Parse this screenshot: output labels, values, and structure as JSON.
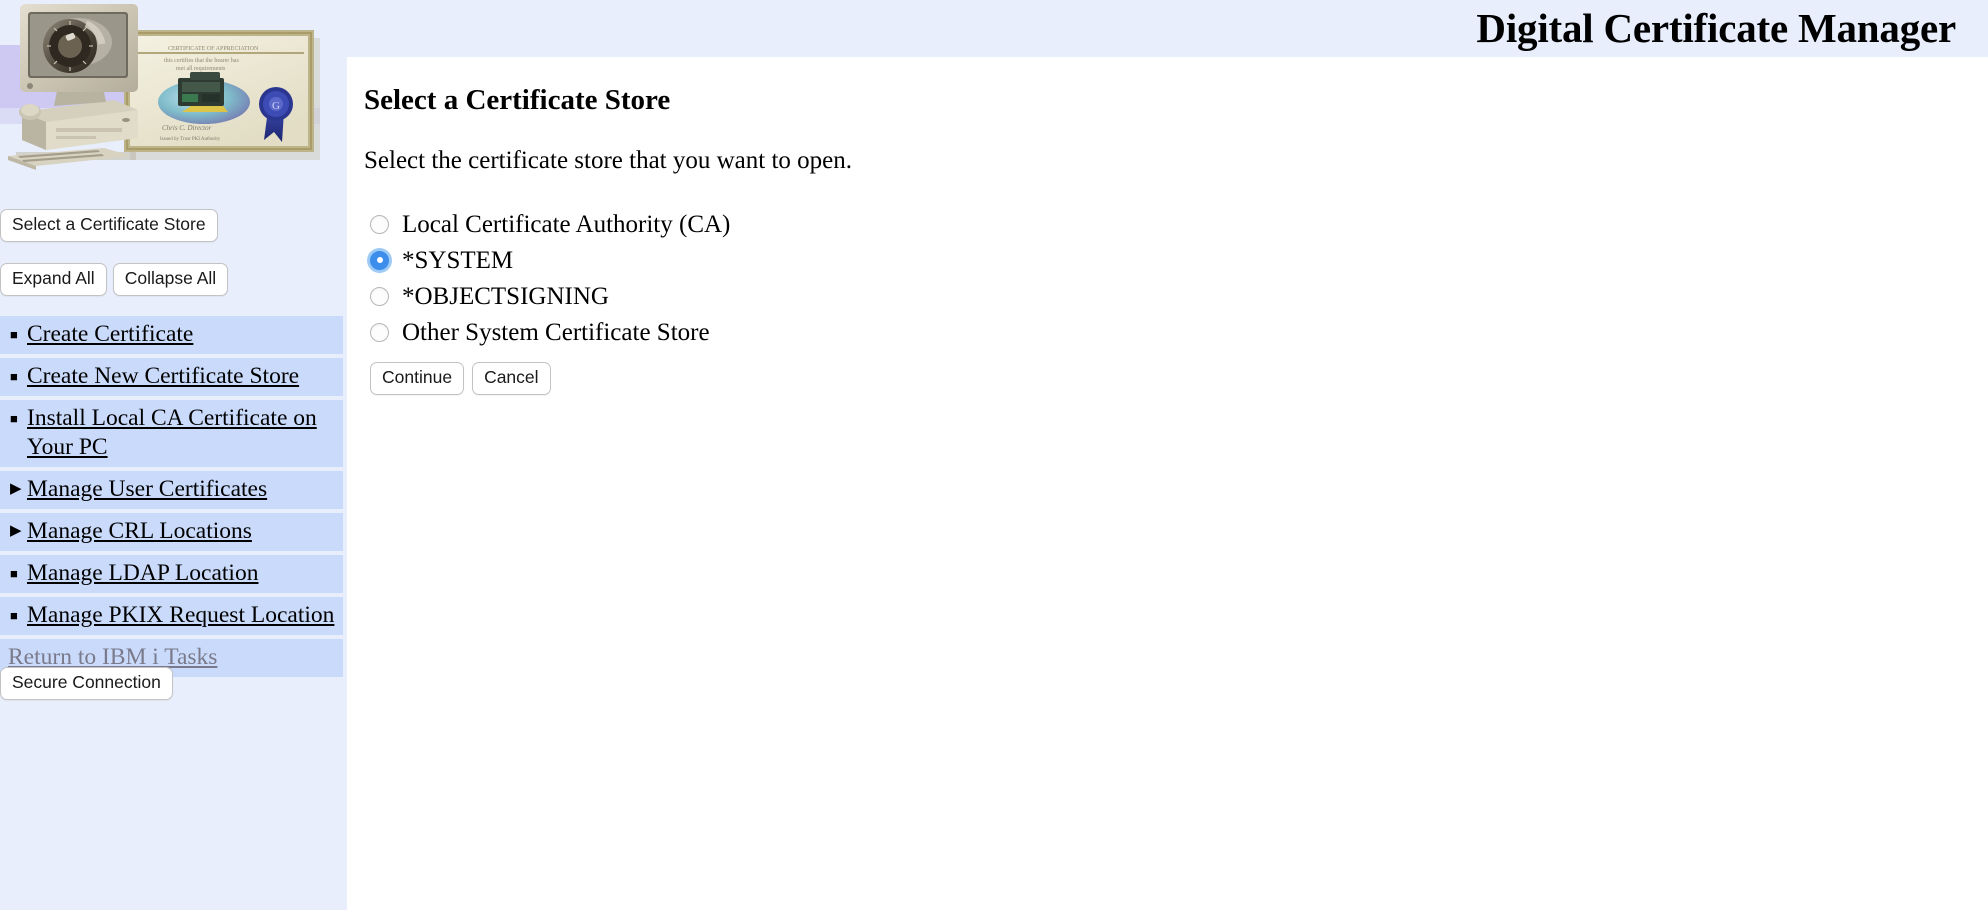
{
  "header": {
    "title": "Digital Certificate Manager",
    "background_color": "#e8eefc"
  },
  "sidebar": {
    "background_color": "#e8eefb",
    "nav_item_color": "#c9dafb",
    "banner": {
      "alt": "Computer monitor with combination-lock dial and a framed certificate with blue ribbon seal",
      "icon": "certificate-banner-image"
    },
    "store_button": {
      "label": "Select a Certificate Store",
      "icon": "certificate-store-button"
    },
    "expand_button": {
      "label": "Expand All",
      "icon": "expand-all-button"
    },
    "collapse_button": {
      "label": "Collapse All",
      "icon": "collapse-all-button"
    },
    "items": [
      {
        "label": "Create Certificate",
        "marker": "■",
        "marker_type": "square",
        "visited": false
      },
      {
        "label": "Create New Certificate Store",
        "marker": "■",
        "marker_type": "square",
        "visited": false
      },
      {
        "label": "Install Local CA Certificate on Your PC",
        "marker": "■",
        "marker_type": "square",
        "visited": false
      },
      {
        "label": "Manage User Certificates",
        "marker": "▶",
        "marker_type": "triangle",
        "visited": false
      },
      {
        "label": "Manage CRL Locations",
        "marker": "▶",
        "marker_type": "triangle",
        "visited": false
      },
      {
        "label": "Manage LDAP Location",
        "marker": "■",
        "marker_type": "square",
        "visited": false
      },
      {
        "label": "Manage PKIX Request Location",
        "marker": "■",
        "marker_type": "square",
        "visited": false
      },
      {
        "label": "Return to IBM i Tasks",
        "marker": "",
        "marker_type": "none",
        "visited": true
      }
    ],
    "secure_connection_button": {
      "label": "Secure Connection",
      "icon": "secure-connection-button"
    }
  },
  "main": {
    "heading": "Select a Certificate Store",
    "intro": "Select the certificate store that you want to open.",
    "radio_group": {
      "name": "certificate-store",
      "selected": "*SYSTEM",
      "selected_color": "#3c8dec",
      "options": [
        {
          "label": "Local Certificate Authority (CA)",
          "checked": false
        },
        {
          "label": "*SYSTEM",
          "checked": true
        },
        {
          "label": "*OBJECTSIGNING",
          "checked": false
        },
        {
          "label": "Other System Certificate Store",
          "checked": false
        }
      ]
    },
    "continue_button": {
      "label": "Continue"
    },
    "cancel_button": {
      "label": "Cancel"
    }
  }
}
